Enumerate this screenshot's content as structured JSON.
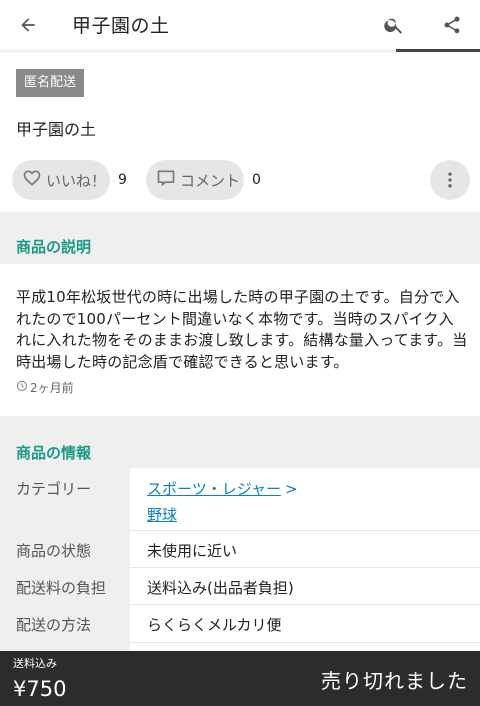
{
  "appbar": {
    "title": "甲子園の土",
    "back_icon": "arrow-left-icon",
    "search_icon": "search-icon",
    "share_icon": "share-icon"
  },
  "item": {
    "badge": "匿名配送",
    "name": "甲子園の土"
  },
  "actions": {
    "like_label": "いいね！",
    "like_count": "9",
    "comment_label": "コメント",
    "comment_count": "0",
    "more_icon": "more-vertical-icon"
  },
  "description": {
    "heading": "商品の説明",
    "text": "平成10年松坂世代の時に出場した時の甲子園の土です。自分で入れたので100パーセント間違いなく本物です。当時のスパイク入れに入れた物をそのままお渡し致します。結構な量入ってます。当時出場した時の記念盾で確認できると思います。",
    "time": "2ヶ月前"
  },
  "info": {
    "heading": "商品の情報",
    "category_label": "カテゴリー",
    "category_link1": "スポーツ・レジャー",
    "category_chevron": ">",
    "category_link2": "野球",
    "condition_label": "商品の状態",
    "condition_value": "未使用に近い",
    "shipping_fee_label": "配送料の負担",
    "shipping_fee_value": "送料込み(出品者負担)",
    "shipping_method_label": "配送の方法",
    "shipping_method_value": "らくらくメルカリ便"
  },
  "bottom": {
    "shipping": "送料込み",
    "price": "¥750",
    "status": "売り切れました"
  },
  "colors": {
    "accent": "#1a9988",
    "link": "#0a7fc7",
    "bottom_bar": "#2c2c2c"
  }
}
